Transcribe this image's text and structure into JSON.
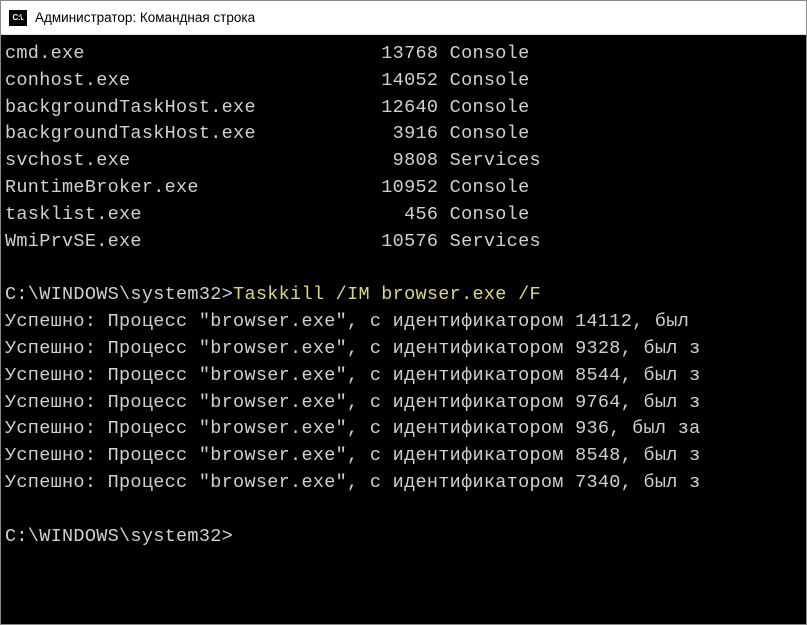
{
  "titlebar": {
    "icon_text": "C:\\.",
    "title": "Администратор: Командная строка"
  },
  "processes": [
    {
      "name": "cmd.exe",
      "pid": "13768",
      "session": "Console"
    },
    {
      "name": "conhost.exe",
      "pid": "14052",
      "session": "Console"
    },
    {
      "name": "backgroundTaskHost.exe",
      "pid": "12640",
      "session": "Console"
    },
    {
      "name": "backgroundTaskHost.exe",
      "pid": "3916",
      "session": "Console"
    },
    {
      "name": "svchost.exe",
      "pid": "9808",
      "session": "Services"
    },
    {
      "name": "RuntimeBroker.exe",
      "pid": "10952",
      "session": "Console"
    },
    {
      "name": "tasklist.exe",
      "pid": "456",
      "session": "Console"
    },
    {
      "name": "WmiPrvSE.exe",
      "pid": "10576",
      "session": "Services"
    }
  ],
  "prompt_path": "C:\\WINDOWS\\system32>",
  "command": "Taskkill /IM browser.exe /F",
  "kill_prefix": "Успешно: Процесс \"browser.exe\", с идентификатором ",
  "kill_suffix_cut": ", был з",
  "kill_results": [
    {
      "pid": "14112",
      "tail": ", был "
    },
    {
      "pid": "9328",
      "tail": ", был з"
    },
    {
      "pid": "8544",
      "tail": ", был з"
    },
    {
      "pid": "9764",
      "tail": ", был з"
    },
    {
      "pid": "936",
      "tail": ", был за"
    },
    {
      "pid": "8548",
      "tail": ", был з"
    },
    {
      "pid": "7340",
      "tail": ", был з"
    }
  ]
}
